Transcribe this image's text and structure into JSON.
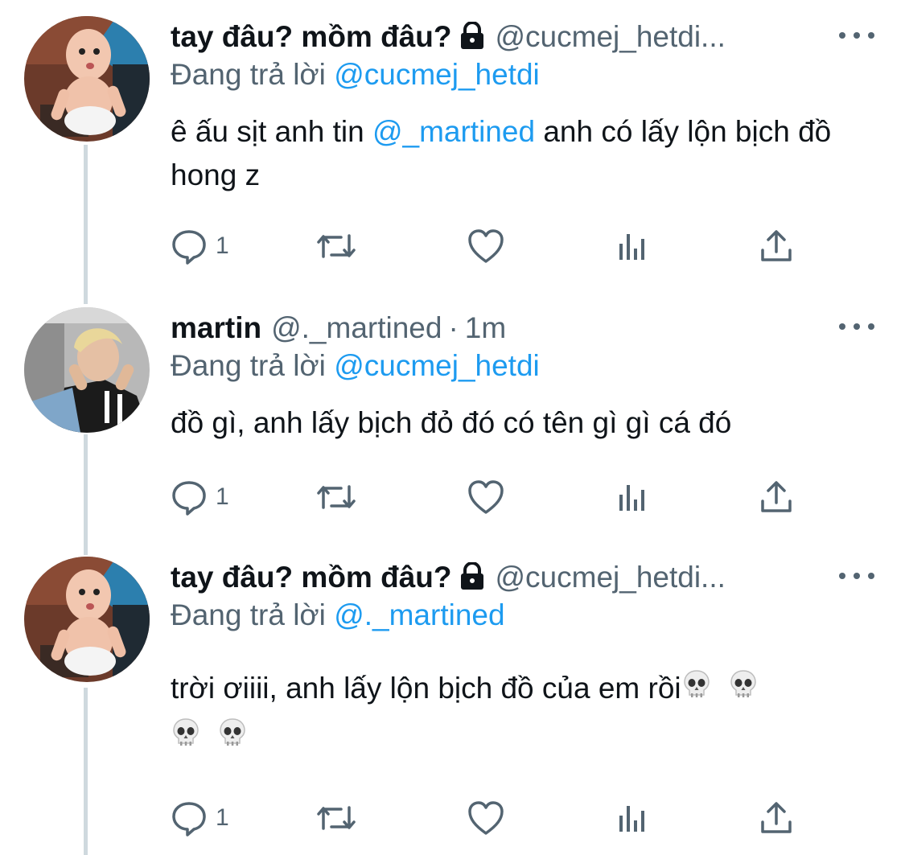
{
  "tweets": [
    {
      "name": "tay đâu? mồm đâu?",
      "handle": "@cucmej_hetdi...",
      "locked": true,
      "time": "",
      "reply_prefix": "Đang trả lời",
      "reply_to": "@cucmej_hetdi",
      "text_before": "ê ấu sịt anh tin",
      "mention": "@_martined",
      "text_after": "anh có lấy lộn bịch đồ hong z",
      "reply_count": "1"
    },
    {
      "name": "martin",
      "handle": "@._martined",
      "separator": "·",
      "time": "1m",
      "reply_prefix": "Đang trả lời",
      "reply_to": "@cucmej_hetdi",
      "text": "đồ gì, anh lấy bịch đỏ đó có tên gì gì cá đó",
      "reply_count": "1"
    },
    {
      "name": "tay đâu? mồm đâu?",
      "handle": "@cucmej_hetdi...",
      "locked": true,
      "reply_prefix": "Đang trả lời",
      "reply_to": "@._martined",
      "text": "trời ơiiii, anh lấy lộn bịch đồ của em rồi",
      "emoji": "skull",
      "reply_count": "1"
    }
  ],
  "icons": {
    "reply": "reply-bubble-icon",
    "retweet": "retweet-icon",
    "like": "heart-icon",
    "views": "analytics-bars-icon",
    "share": "share-upload-icon",
    "more": "more-dots-icon",
    "lock": "lock-icon"
  },
  "colors": {
    "link": "#1d9bf0",
    "secondary": "#536471",
    "text": "#0f1419",
    "thread_line": "#cfd9de"
  }
}
